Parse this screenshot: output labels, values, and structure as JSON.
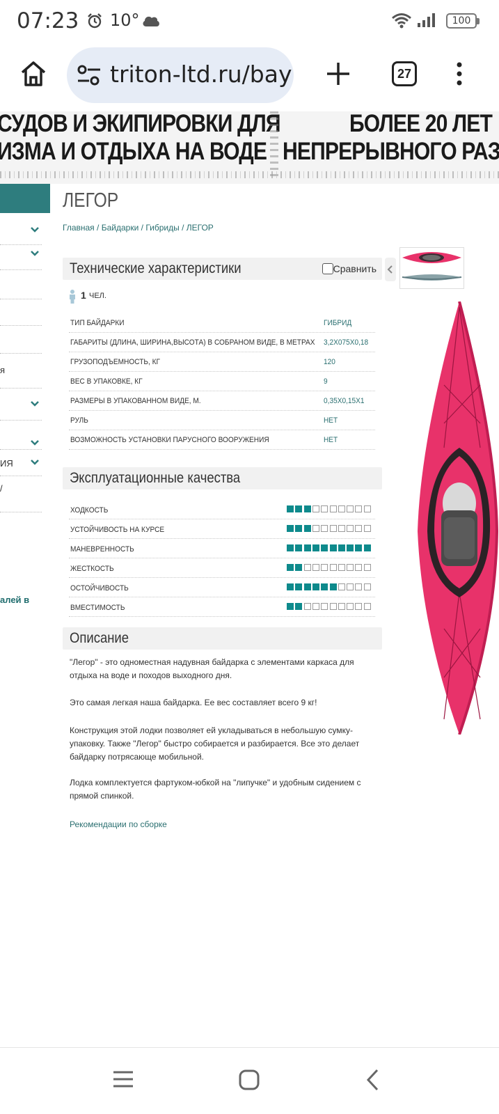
{
  "status_bar": {
    "time": "07:23",
    "temperature": "10°",
    "battery": "100"
  },
  "browser": {
    "url": "triton-ltd.ru/bay",
    "tab_count": "27"
  },
  "banner": {
    "left_line1": "СУДОВ И ЭКИПИРОВКИ ДЛЯ",
    "left_line2": "ИЗМА И ОТДЫХА НА ВОДЕ",
    "right_line1": "БОЛЕЕ 20 ЛЕТ",
    "right_line2": "НЕПРЕРЫВНОГО РАЗВ"
  },
  "sidebar": {
    "fragments": [
      "я",
      "ИЯ",
      "/",
      "алей в"
    ]
  },
  "page": {
    "title": "ЛЕГОР",
    "breadcrumb": [
      "Главная",
      "/",
      "Байдарки",
      "/",
      "Гибриды",
      "/",
      "ЛЕГОР"
    ]
  },
  "specs": {
    "title": "Технические характеристики",
    "compare_label": "Сравнить",
    "persons_count": "1",
    "persons_unit": "ЧЕЛ.",
    "rows": [
      {
        "label": "ТИП БАЙДАРКИ",
        "value": "ГИБРИД"
      },
      {
        "label": "ГАБАРИТЫ (ДЛИНА, ШИРИНА,ВЫСОТА) В СОБРАНОМ ВИДЕ, В МЕТРАХ",
        "value": "3,2Х075Х0,18"
      },
      {
        "label": "ГРУЗОПОДЪЕМНОСТЬ, КГ",
        "value": "120"
      },
      {
        "label": "ВЕС В УПАКОВКЕ, КГ",
        "value": "9"
      },
      {
        "label": "РАЗМЕРЫ В УПАКОВАННОМ ВИДЕ, М.",
        "value": "0,35Х0,15Х1"
      },
      {
        "label": "РУЛЬ",
        "value": "НЕТ"
      },
      {
        "label": "ВОЗМОЖНОСТЬ УСТАНОВКИ ПАРУСНОГО ВООРУЖЕНИЯ",
        "value": "НЕТ"
      }
    ]
  },
  "qualities": {
    "title": "Эксплуатационные качества",
    "max": 10,
    "rows": [
      {
        "label": "ХОДКОСТЬ",
        "score": 3
      },
      {
        "label": "УСТОЙЧИВОСТЬ НА КУРСЕ",
        "score": 3
      },
      {
        "label": "МАНЕВРЕННОСТЬ",
        "score": 10
      },
      {
        "label": "ЖЕСТКОСТЬ",
        "score": 2
      },
      {
        "label": "ОСТОЙЧИВОСТЬ",
        "score": 6
      },
      {
        "label": "ВМЕСТИМОСТЬ",
        "score": 2
      }
    ]
  },
  "description": {
    "title": "Описание",
    "paragraphs": [
      "\"Легор\" - это одноместная надувная байдарка с элементами каркаса для отдыха на воде и походов выходного дня.",
      "Это самая легкая наша байдарка. Ее вес составляет всего 9 кг!",
      "Конструкция этой лодки позволяет ей укладываться в небольшую сумку-упаковку. Также \"Легор\" быстро собирается и разбирается. Все это делает байдарку потрясающе мобильной.",
      "Лодка комплектуется фартуком-юбкой на \"липучке\" и удобным сидением с прямой спинкой."
    ],
    "link": "Рекомендации по сборке"
  },
  "colors": {
    "accent": "#0e8a8c",
    "link": "#2a6f70",
    "kayak": "#e8326a",
    "sidebar": "#2e7d7e"
  }
}
